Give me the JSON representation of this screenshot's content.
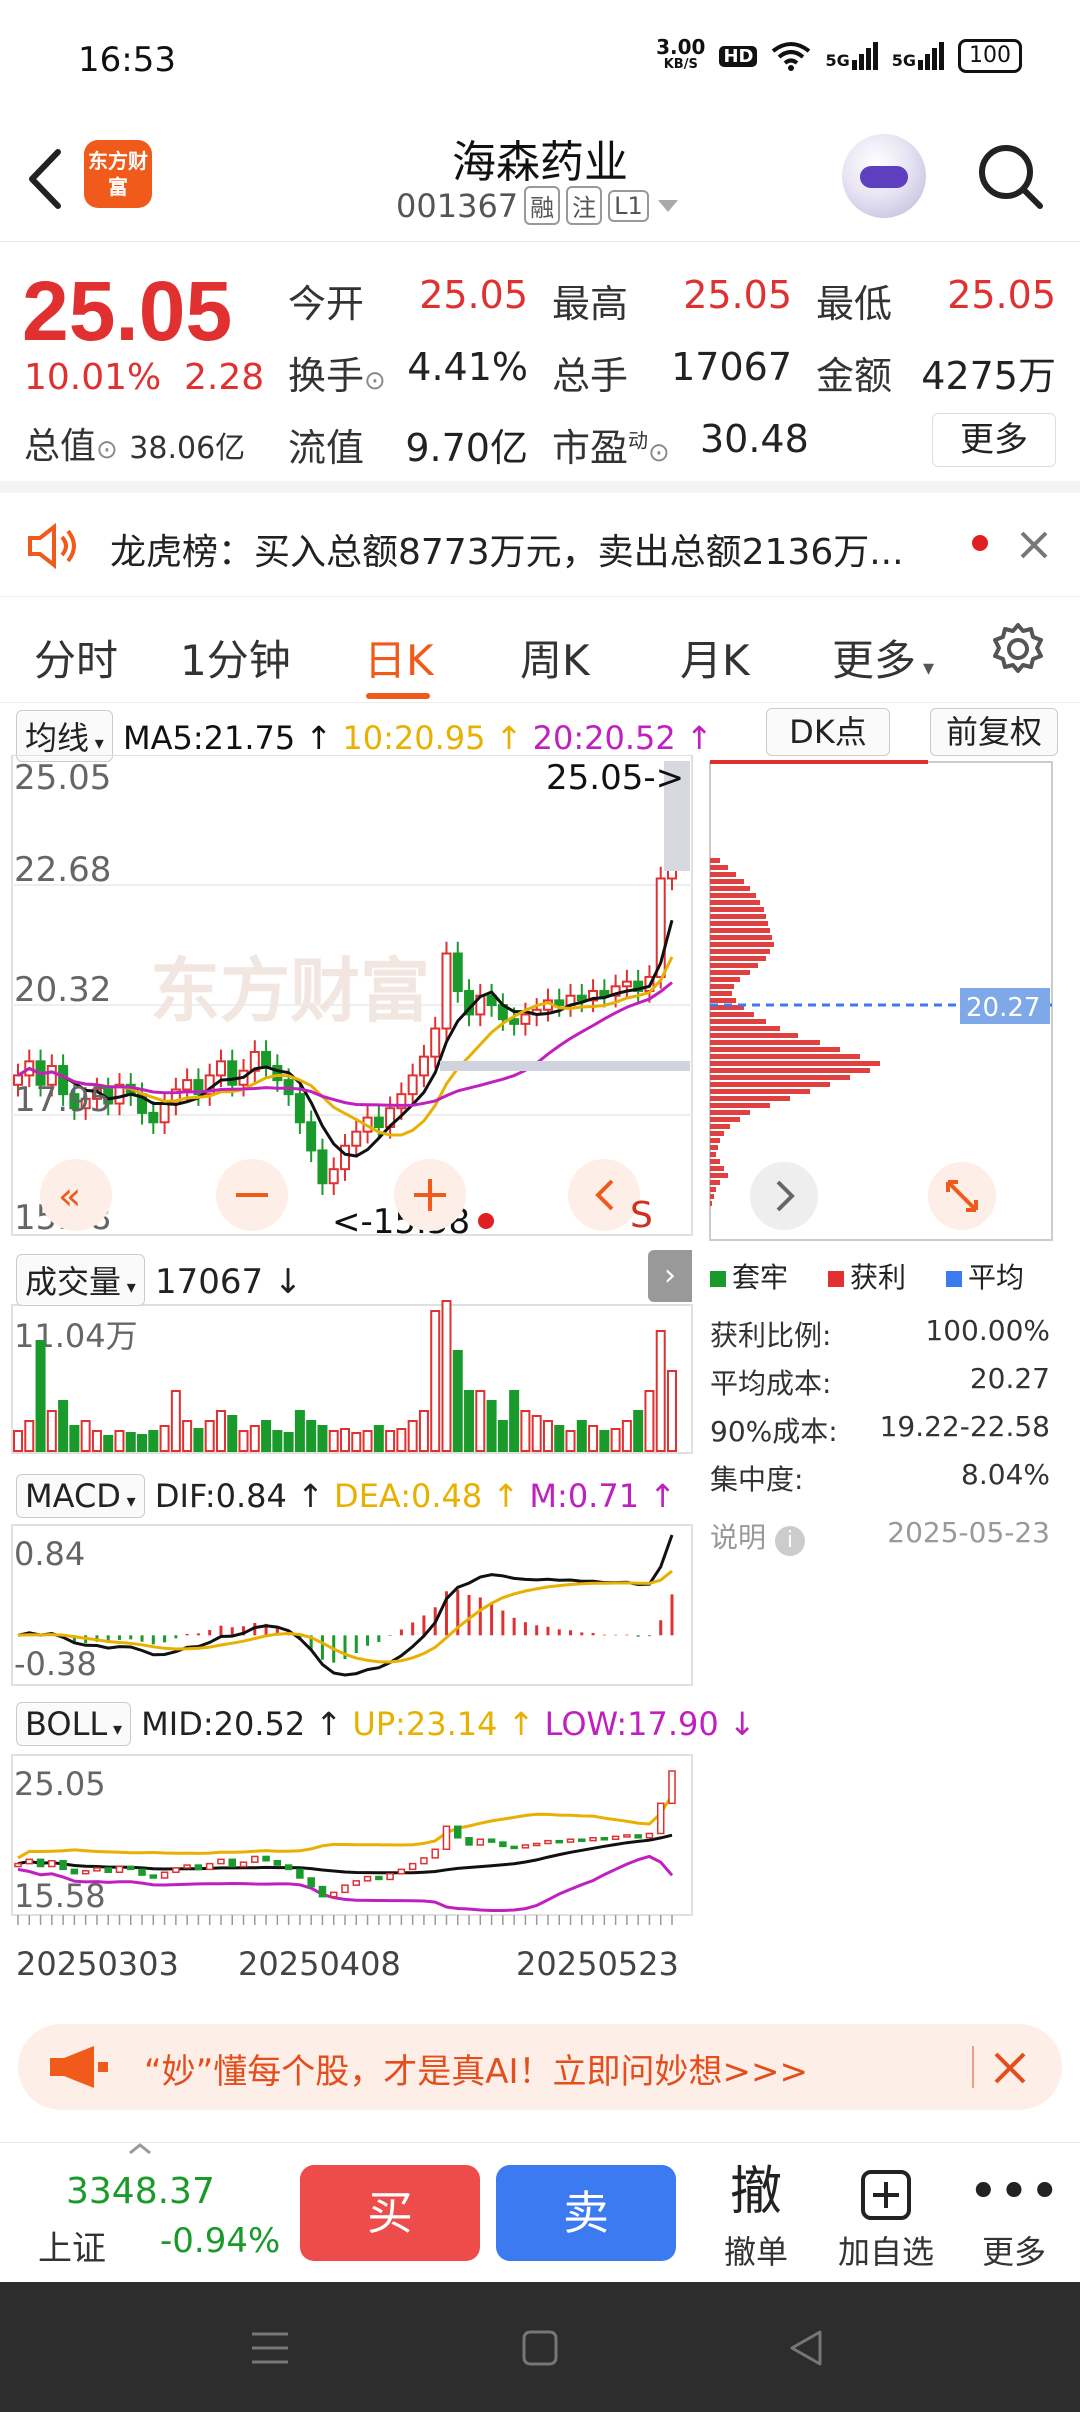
{
  "status_bar": {
    "time": "16:53",
    "net_speed": "3.00",
    "net_unit": "KB/S",
    "hd": "HD",
    "sig1": "5G",
    "sig2": "5G",
    "battery": "100"
  },
  "header": {
    "logo": "东方财富",
    "stock_name": "海森药业",
    "stock_code": "001367",
    "tags": [
      "融",
      "注",
      "L1"
    ]
  },
  "quote": {
    "price": "25.05",
    "change_pct": "10.01%",
    "change_amt": "2.28",
    "open_label": "今开",
    "open": "25.05",
    "high_label": "最高",
    "high": "25.05",
    "low_label": "最低",
    "low": "25.05",
    "turnover_label": "换手",
    "turnover": "4.41%",
    "volume_label": "总手",
    "volume": "17067",
    "amount_label": "金额",
    "amount": "4275万",
    "mcap_label": "总值",
    "mcap": "38.06亿",
    "float_label": "流值",
    "float_cap": "9.70亿",
    "pe_label": "市盈",
    "pe_sup": "动",
    "pe": "30.48",
    "more": "更多"
  },
  "notice": {
    "text": "龙虎榜：买入总额8773万元，卖出总额2136万..."
  },
  "tabs": [
    "分时",
    "1分钟",
    "日K",
    "周K",
    "月K",
    "更多"
  ],
  "active_tab": "日K",
  "kline": {
    "ma_selector": "均线",
    "ma5": "MA5:21.75",
    "ma10": "10:20.95",
    "ma20": "20:20.52",
    "dk_label": "DK点",
    "fq_label": "前复权",
    "y_labels": [
      "25.05",
      "22.68",
      "20.32",
      "17.95",
      "15.58"
    ],
    "high_marker": "25.05->",
    "low_marker": "<-15.58",
    "s_marker": "S"
  },
  "chip": {
    "avg_label": "20.27",
    "legend": [
      "套牢",
      "获利",
      "平均"
    ],
    "stats": [
      {
        "label": "获利比例:",
        "value": "100.00%"
      },
      {
        "label": "平均成本:",
        "value": "20.27"
      },
      {
        "label": "90%成本:",
        "value": "19.22-22.58"
      },
      {
        "label": "集中度:",
        "value": "8.04%"
      }
    ],
    "note_label": "说明",
    "date": "2025-05-23"
  },
  "volume": {
    "selector": "成交量",
    "value": "17067",
    "y_label": "11.04万"
  },
  "macd": {
    "selector": "MACD",
    "dif": "DIF:0.84",
    "dea": "DEA:0.48",
    "m": "M:0.71",
    "y_top": "0.84",
    "y_bot": "-0.38"
  },
  "boll": {
    "selector": "BOLL",
    "mid": "MID:20.52",
    "up": "UP:23.14",
    "low": "LOW:17.90",
    "y_top": "25.05",
    "y_bot": "15.58"
  },
  "dates": [
    "20250303",
    "20250408",
    "20250523"
  ],
  "promo": {
    "text": "“妙”懂每个股，才是真AI！立即问妙想>>>"
  },
  "tradebar": {
    "index_value": "3348.37",
    "index_name": "上证",
    "index_change": "-0.94%",
    "buy": "买",
    "sell": "卖",
    "cancel_icon": "撤",
    "cancel": "撤单",
    "add": "加自选",
    "more": "更多"
  },
  "colors": {
    "up": "#e03030",
    "down": "#1a9a2a",
    "accent": "#f05a1a",
    "ma10": "#e8b000",
    "ma20": "#c020c0"
  }
}
